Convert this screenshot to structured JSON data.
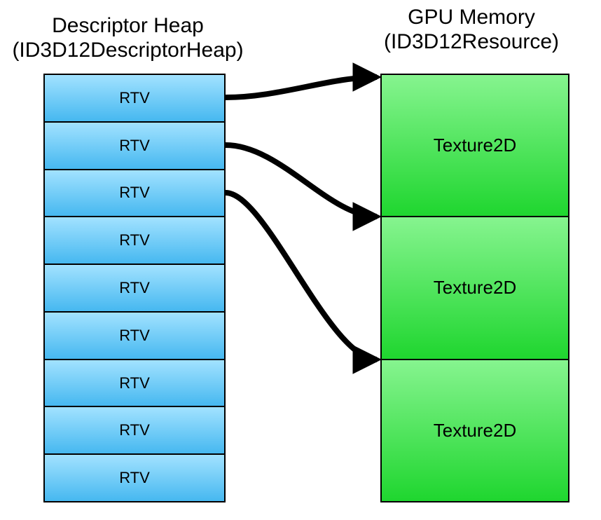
{
  "left_title_line1": "Descriptor Heap",
  "left_title_line2": "(ID3D12DescriptorHeap)",
  "right_title_line1": "GPU Memory",
  "right_title_line2": "(ID3D12Resource)",
  "heap_cells": [
    "RTV",
    "RTV",
    "RTV",
    "RTV",
    "RTV",
    "RTV",
    "RTV",
    "RTV",
    "RTV"
  ],
  "gpu_cells": [
    "Texture2D",
    "Texture2D",
    "Texture2D"
  ],
  "colors": {
    "heap_gradient_top": "#a2e2ff",
    "heap_gradient_bottom": "#46b8f0",
    "gpu_gradient_top": "#86f48f",
    "gpu_gradient_bottom": "#1fd62f",
    "stroke": "#000000"
  },
  "arrows": [
    {
      "from_heap_index": 0,
      "to_gpu_boundary": 0
    },
    {
      "from_heap_index": 1,
      "to_gpu_boundary": 1
    },
    {
      "from_heap_index": 2,
      "to_gpu_boundary": 2
    }
  ]
}
